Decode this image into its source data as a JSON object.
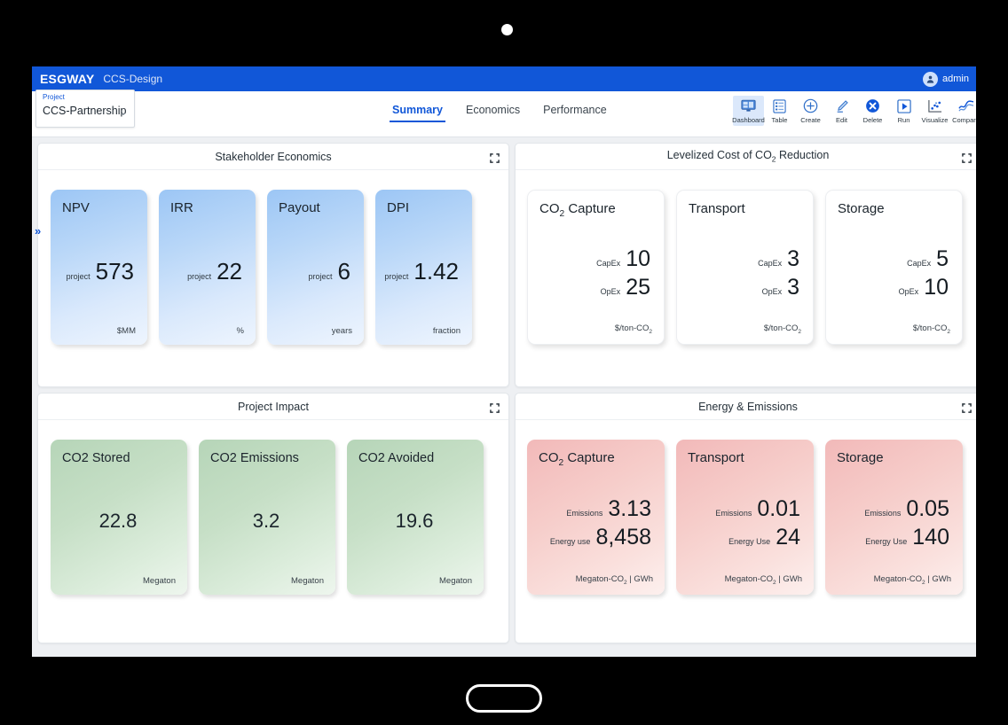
{
  "app": {
    "brand": "ESGWAY",
    "subtitle": "CCS-Design",
    "user": "admin",
    "avatar_icon": "user-icon"
  },
  "project_select": {
    "label": "Project",
    "value": "CCS-Partnership",
    "chevron_icon": "chevron-down-icon"
  },
  "tabs": [
    {
      "label": "Summary",
      "active": true
    },
    {
      "label": "Economics",
      "active": false
    },
    {
      "label": "Performance",
      "active": false
    }
  ],
  "toolbar": [
    {
      "label": "Dashboard",
      "icon": "dashboard-icon",
      "selected": true
    },
    {
      "label": "Table",
      "icon": "table-icon",
      "selected": false
    },
    {
      "label": "Create",
      "icon": "plus-circle-icon",
      "selected": false
    },
    {
      "label": "Edit",
      "icon": "pencil-icon",
      "selected": false
    },
    {
      "label": "Delete",
      "icon": "x-circle-icon",
      "selected": false
    },
    {
      "label": "Run",
      "icon": "play-icon",
      "selected": false
    },
    {
      "label": "Visualize",
      "icon": "scatter-chart-icon",
      "selected": false
    },
    {
      "label": "Compare",
      "icon": "line-chart-icon",
      "selected": false
    }
  ],
  "expand_rail": "»",
  "panels": {
    "stakeholder": {
      "title": "Stakeholder Economics",
      "expand_icon": "expand-icon",
      "cards": [
        {
          "title": "NPV",
          "label": "project",
          "value": "573",
          "unit": "$MM"
        },
        {
          "title": "IRR",
          "label": "project",
          "value": "22",
          "unit": "%"
        },
        {
          "title": "Payout",
          "label": "project",
          "value": "6",
          "unit": "years"
        },
        {
          "title": "DPI",
          "label": "project",
          "value": "1.42",
          "unit": "fraction"
        }
      ]
    },
    "levelized": {
      "title_pre": "Levelized Cost of CO",
      "title_sub": "2",
      "title_post": " Reduction",
      "expand_icon": "expand-icon",
      "unit_pre": "$/ton-CO",
      "unit_sub": "2",
      "cards": [
        {
          "title_pre": "CO",
          "title_sub": "2",
          "title_post": " Capture",
          "capex_label": "CapEx",
          "capex": "10",
          "opex_label": "OpEx",
          "opex": "25"
        },
        {
          "title_pre": "Transport",
          "title_sub": "",
          "title_post": "",
          "capex_label": "CapEx",
          "capex": "3",
          "opex_label": "OpEx",
          "opex": "3"
        },
        {
          "title_pre": "Storage",
          "title_sub": "",
          "title_post": "",
          "capex_label": "CapEx",
          "capex": "5",
          "opex_label": "OpEx",
          "opex": "10"
        }
      ]
    },
    "impact": {
      "title": "Project Impact",
      "expand_icon": "expand-icon",
      "cards": [
        {
          "title": "CO2 Stored",
          "value": "22.8",
          "unit": "Megaton"
        },
        {
          "title": "CO2 Emissions",
          "value": "3.2",
          "unit": "Megaton"
        },
        {
          "title": "CO2 Avoided",
          "value": "19.6",
          "unit": "Megaton"
        }
      ]
    },
    "energy": {
      "title": "Energy & Emissions",
      "expand_icon": "expand-icon",
      "unit_pre": "Megaton-CO",
      "unit_sub": "2",
      "unit_post": " | GWh",
      "cards": [
        {
          "title_pre": "CO",
          "title_sub": "2",
          "title_post": " Capture",
          "em_label": "Emissions",
          "emissions": "3.13",
          "en_label": "Energy use",
          "energy": "8,458"
        },
        {
          "title_pre": "Transport",
          "title_sub": "",
          "title_post": "",
          "em_label": "Emissions",
          "emissions": "0.01",
          "en_label": "Energy Use",
          "energy": "24"
        },
        {
          "title_pre": "Storage",
          "title_sub": "",
          "title_post": "",
          "em_label": "Emissions",
          "emissions": "0.05",
          "en_label": "Energy Use",
          "energy": "140"
        }
      ]
    }
  },
  "colors": {
    "brand_blue": "#1157d8",
    "card_blue": "#9cc6f5",
    "card_green": "#b6d5b8",
    "card_pink": "#f2b9b9"
  }
}
